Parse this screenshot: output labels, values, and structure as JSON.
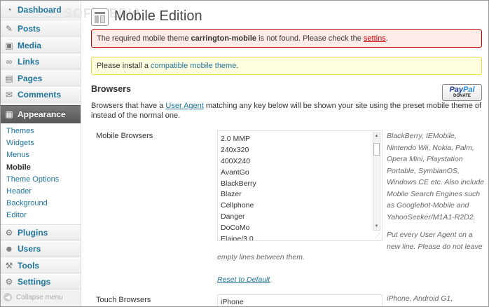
{
  "watermark": "SOFTPEDIA",
  "sidebar": {
    "menu": [
      {
        "label": "Dashboard",
        "icon": "dashboard-icon",
        "glyph": "◔"
      },
      {
        "label": "Posts",
        "icon": "pin-icon",
        "glyph": "✎"
      },
      {
        "label": "Media",
        "icon": "media-icon",
        "glyph": "▣"
      },
      {
        "label": "Links",
        "icon": "links-icon",
        "glyph": "∞"
      },
      {
        "label": "Pages",
        "icon": "pages-icon",
        "glyph": "▤"
      },
      {
        "label": "Comments",
        "icon": "comments-icon",
        "glyph": "✉"
      },
      {
        "label": "Appearance",
        "icon": "appearance-icon",
        "glyph": "▦"
      },
      {
        "label": "Plugins",
        "icon": "plugins-icon",
        "glyph": "⚙"
      },
      {
        "label": "Users",
        "icon": "users-icon",
        "glyph": "☻"
      },
      {
        "label": "Tools",
        "icon": "tools-icon",
        "glyph": "⚒"
      },
      {
        "label": "Settings",
        "icon": "settings-icon",
        "glyph": "⚙"
      }
    ],
    "submenu": [
      "Themes",
      "Widgets",
      "Menus",
      "Mobile",
      "Theme Options",
      "Header",
      "Background",
      "Editor"
    ],
    "collapse_label": "Collapse menu"
  },
  "page": {
    "title": "Mobile Edition",
    "error_notice": {
      "prefix": "The required mobile theme ",
      "theme": "carrington-mobile",
      "middle": " is not found. Please check the ",
      "link": "settins",
      "suffix": "."
    },
    "update_notice": {
      "prefix": "Please install a ",
      "link": "compatible mobile theme",
      "suffix": "."
    },
    "section_title": "Browsers",
    "paypal": {
      "pay": "Pay",
      "pal": "Pal",
      "donate": "DONATE"
    },
    "description": {
      "prefix": "Browsers that have a ",
      "link": "User Agent",
      "suffix": " matching any key below will be shown your site using the preset mobile theme of instead of the normal one."
    },
    "mobile_browsers": {
      "label": "Mobile Browsers",
      "lines": [
        "2.0 MMP",
        "240x320",
        "400X240",
        "AvantGo",
        "BlackBerry",
        "Blazer",
        "Cellphone",
        "Danger",
        "DoCoMo",
        "Elaine/3.0"
      ],
      "help_lines": [
        "BlackBerry, IEMobile,",
        "Nintendo Wii, Nokia, Palm,",
        "Opera Mini, Playstation",
        "Portable, SymbianOS,",
        "Windows CE etc. Also include",
        "Mobile Search Engines such",
        "as Googlebot-Mobile and",
        "YahooSeeker/M1A1-R2D2."
      ],
      "help2_lines": [
        "Put every User Agent on a",
        "new line. Please do not leave"
      ],
      "help2_cont": "empty lines between them.",
      "reset_label": "Reset to Default"
    },
    "touch_browsers": {
      "label": "Touch Browsers",
      "lines": [
        "iPhone"
      ],
      "help_lines": [
        "iPhone, Android G1,"
      ]
    }
  }
}
